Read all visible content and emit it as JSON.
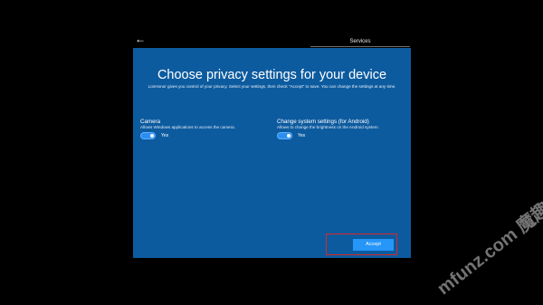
{
  "nav": {
    "back_icon": "←",
    "tab_label": "Services"
  },
  "dialog": {
    "title": "Choose privacy settings for your device",
    "description": "LonHonor gives you control of your privacy. Select your settings, then check \"Accept\" to save. You can change the settings at any time.",
    "settings": [
      {
        "title": "Camera",
        "description": "Allows Windows applications to access the camera.",
        "state": "Yes"
      },
      {
        "title": "Change system settings (for Android)",
        "description": "Allows to change the brightness on the Android system.",
        "state": "Yes"
      }
    ],
    "accept_label": "Accept"
  },
  "watermark": "mfunz.com 魔趣网",
  "colors": {
    "background": "#000000",
    "dialog": "#0d5b9f",
    "accent": "#2696f8",
    "highlight": "#d82828"
  }
}
